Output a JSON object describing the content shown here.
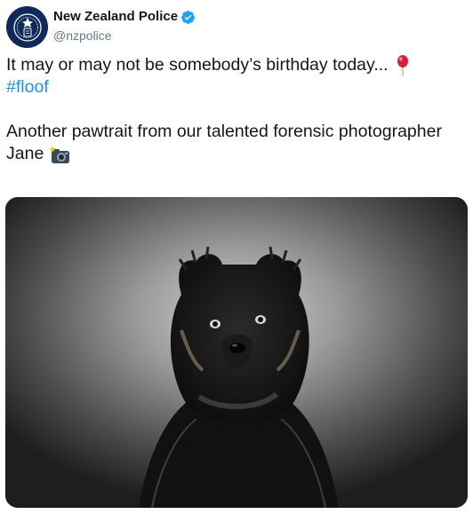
{
  "account": {
    "display_name": "New Zealand Police",
    "handle": "@nzpolice",
    "avatar_icon": "police-badge-icon",
    "verified_icon": "verified-badge-icon"
  },
  "tweet": {
    "line1": "It may or may not be somebody’s birthday today...",
    "line1_emoji": "balloon-icon",
    "hashtag": "#floof",
    "line3": "Another pawtrait from our talented forensic photographer",
    "line4": "Jane",
    "line4_emoji": "camera-with-flash-icon"
  },
  "media": {
    "type": "photo",
    "subject": "black-and-white-puppy-photo"
  },
  "colors": {
    "text": "#14171a",
    "secondary": "#657786",
    "link": "#1b95e0",
    "verified": "#1da1f2"
  }
}
